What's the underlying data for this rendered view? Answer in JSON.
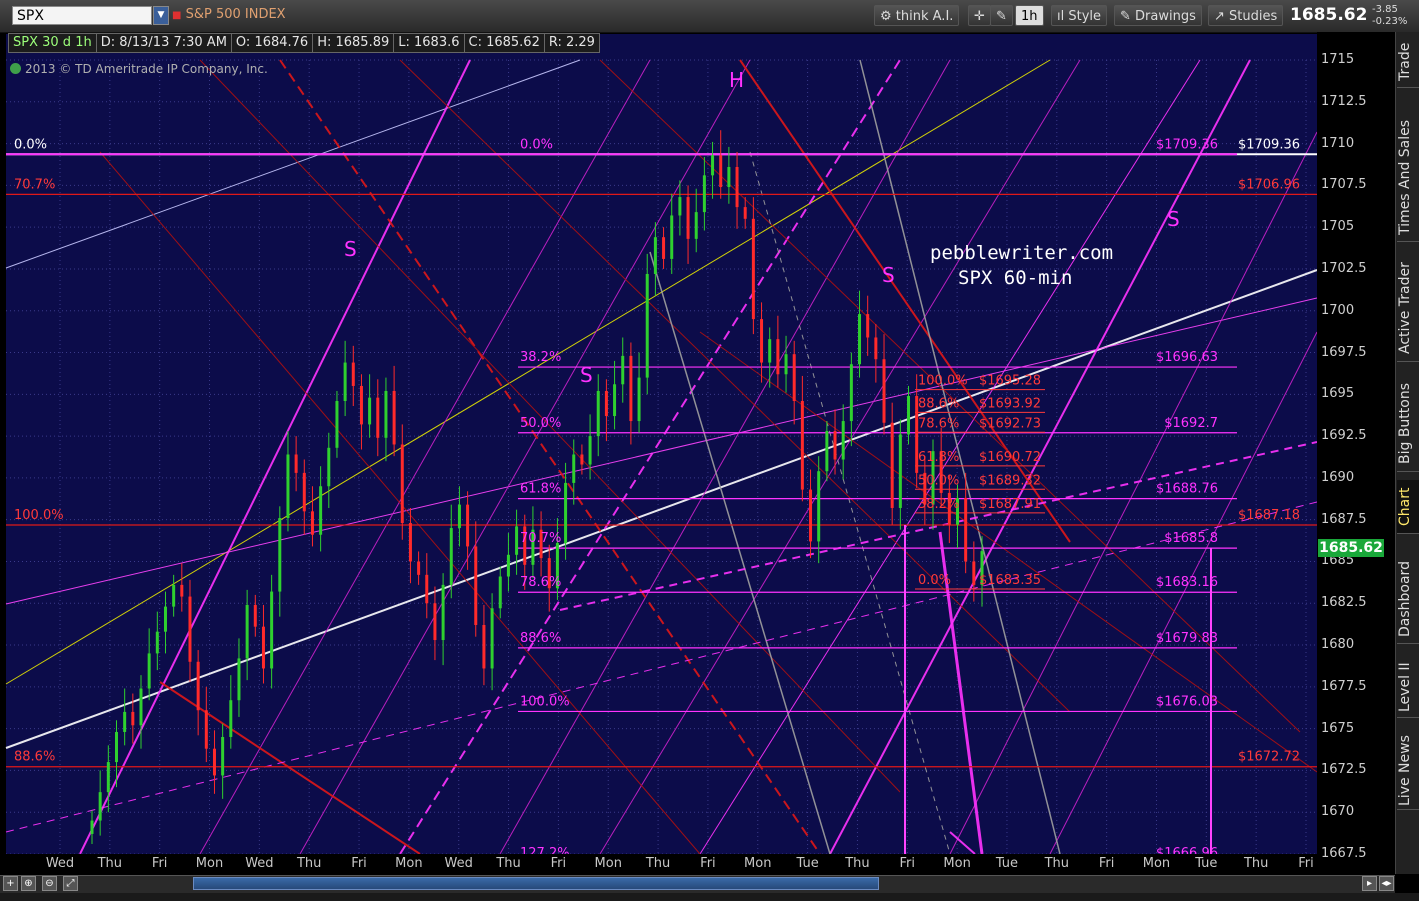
{
  "toolbar": {
    "symbol": "SPX",
    "symbol_name": "S&P 500 INDEX",
    "think_ai": "think A.I.",
    "timeframe": "1h",
    "style": "Style",
    "drawings": "Drawings",
    "studies": "Studies",
    "last_price": "1685.62",
    "change": "-3.85",
    "change_pct": "-0.23%"
  },
  "info": {
    "aggregation": "SPX 30 d 1h",
    "date": "D: 8/13/13 7:30 AM",
    "open": "O: 1684.76",
    "high": "H: 1685.89",
    "low": "L: 1683.6",
    "close": "C: 1685.62",
    "range": "R: 2.29"
  },
  "copyright": "2013 © TD Ameritrade IP Company, Inc.",
  "annotation": {
    "line1": "pebblewriter.com",
    "line2": "SPX 60-min"
  },
  "right_tabs": [
    "Trade",
    "Times And Sales",
    "Active Trader",
    "Big Buttons",
    "Chart",
    "Dashboard",
    "Level II",
    "Live News"
  ],
  "colors": {
    "background": "#0c0c4a",
    "up_candle": "#2fd12f",
    "down_candle": "#ff2a2a",
    "magenta": "#ff33ff",
    "red_line": "#e01818",
    "white_line": "#ffffff"
  },
  "chart_data": {
    "type": "candlestick",
    "title": "SPX 60-min",
    "ylim": [
      1667.5,
      1715
    ],
    "y_ticks": [
      1715,
      1712.5,
      1710,
      1707.5,
      1705,
      1702.5,
      1700,
      1697.5,
      1695,
      1692.5,
      1690,
      1687.5,
      1685,
      1682.5,
      1680,
      1677.5,
      1675,
      1672.5,
      1670,
      1667.5
    ],
    "x_ticks": [
      "Wed",
      "Thu",
      "Fri",
      "Mon",
      "Wed",
      "Thu",
      "Fri",
      "Mon",
      "Wed",
      "Thu",
      "Fri",
      "Mon",
      "Thu",
      "Fri",
      "Mon",
      "Tue",
      "Thu",
      "Fri",
      "Mon",
      "Tue",
      "Thu",
      "Fri",
      "Mon",
      "Tue",
      "Thu",
      "Fri"
    ],
    "last": 1685.62,
    "closes": [
      1669.5,
      1671.2,
      1673.0,
      1674.8,
      1676.0,
      1675.2,
      1677.4,
      1679.5,
      1680.8,
      1682.3,
      1683.6,
      1682.9,
      1679.0,
      1676.1,
      1673.8,
      1672.2,
      1674.5,
      1676.7,
      1679.2,
      1682.4,
      1681.1,
      1678.6,
      1683.2,
      1687.6,
      1691.4,
      1690.3,
      1688.0,
      1686.6,
      1689.5,
      1691.8,
      1694.6,
      1696.9,
      1695.5,
      1693.2,
      1694.8,
      1692.4,
      1695.2,
      1692.0,
      1687.3,
      1685.0,
      1684.2,
      1682.5,
      1680.3,
      1683.6,
      1687.0,
      1688.4,
      1685.9,
      1681.2,
      1678.6,
      1682.2,
      1684.1,
      1685.4,
      1687.1,
      1684.8,
      1686.9,
      1685.2,
      1683.4,
      1686.1,
      1689.7,
      1691.4,
      1690.8,
      1692.5,
      1695.2,
      1693.7,
      1695.6,
      1697.3,
      1693.4,
      1696.0,
      1702.2,
      1704.4,
      1703.1,
      1705.7,
      1706.8,
      1704.3,
      1705.9,
      1708.1,
      1709.3,
      1707.4,
      1708.6,
      1706.2,
      1705.5,
      1699.5,
      1696.9,
      1698.3,
      1696.2,
      1697.4,
      1694.6,
      1689.3,
      1686.2,
      1690.4,
      1692.8,
      1691.1,
      1693.4,
      1696.8,
      1699.8,
      1698.4,
      1697.1,
      1693.3,
      1688.2,
      1692.6,
      1694.9,
      1690.3,
      1688.4,
      1691.6,
      1689.1,
      1687.2,
      1688.8,
      1685.0,
      1683.6,
      1685.62
    ],
    "fib_levels_right": [
      {
        "label": "0.0%",
        "value": 1709.36,
        "price_label": "$1709.36"
      },
      {
        "label": "38.2%",
        "value": 1696.63,
        "price_label": "$1696.63"
      },
      {
        "label": "50.0%",
        "value": 1692.7,
        "price_label": "$1692.7"
      },
      {
        "label": "61.8%",
        "value": 1688.76,
        "price_label": "$1688.76"
      },
      {
        "label": "70.7%",
        "value": 1685.8,
        "price_label": "$1685.8"
      },
      {
        "label": "78.6%",
        "value": 1683.16,
        "price_label": "$1683.16"
      },
      {
        "label": "88.6%",
        "value": 1679.83,
        "price_label": "$1679.83"
      },
      {
        "label": "100.0%",
        "value": 1676.03,
        "price_label": "$1676.03"
      },
      {
        "label": "127.2%",
        "value": 1666.96,
        "price_label": "$1666.96"
      }
    ],
    "fib_levels_left": [
      {
        "label": "0.0%",
        "value": 1709.36
      },
      {
        "label": "70.7%",
        "value": 1706.96,
        "price_label": "$1706.96"
      },
      {
        "label": "100.0%",
        "value": 1687.18,
        "price_label": "$1687.18"
      },
      {
        "label": "88.6%",
        "value": 1672.72,
        "price_label": "$1672.72"
      }
    ],
    "fib_levels_small": [
      {
        "label": "100.0%",
        "value": 1695.28,
        "price_label": "$1695.28"
      },
      {
        "label": "88.6%",
        "value": 1693.92,
        "price_label": "$1693.92"
      },
      {
        "label": "78.6%",
        "value": 1692.73,
        "price_label": "$1692.73"
      },
      {
        "label": "61.8%",
        "value": 1690.72,
        "price_label": "$1690.72"
      },
      {
        "label": "50.0%",
        "value": 1689.32,
        "price_label": "$1689.32"
      },
      {
        "label": "38.2%",
        "value": 1687.91,
        "price_label": "$1687.91"
      },
      {
        "label": "0.0%",
        "value": 1683.35,
        "price_label": "$1683.35"
      }
    ],
    "pattern_labels": [
      "S",
      "S",
      "H",
      "S",
      "S"
    ]
  }
}
